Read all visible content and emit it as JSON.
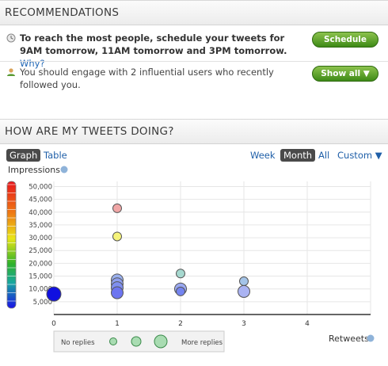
{
  "recommendations": {
    "title": "RECOMMENDATIONS",
    "items": [
      {
        "icon": "clock-icon",
        "text": "To reach the most people, schedule your tweets for 9AM tomorrow, 11AM tomorrow and 3PM tomorrow.",
        "link": "Why?",
        "button": "Schedule"
      },
      {
        "icon": "users-icon",
        "text": "You should engage with 2 influential users who recently followed you.",
        "button": "Show all ▼"
      }
    ]
  },
  "tweets": {
    "title": "HOW ARE MY TWEETS DOING?",
    "view_tabs": [
      "Graph",
      "Table"
    ],
    "active_view": "Graph",
    "range_tabs": [
      "Week",
      "Month",
      "All",
      "Custom ▼"
    ],
    "active_range": "Month"
  },
  "chart_data": {
    "type": "scatter",
    "ylabel": "Impressions",
    "xlabel": "Retweets",
    "xlim": [
      0,
      5
    ],
    "ylim": [
      0,
      52000
    ],
    "x_ticks": [
      "0",
      "1",
      "2",
      "3",
      "4"
    ],
    "y_ticks": [
      "5,000",
      "10,000",
      "15,000",
      "20,000",
      "25,000",
      "30,000",
      "35,000",
      "40,000",
      "45,000",
      "50,000"
    ],
    "colors": {
      "high": "#e8151b",
      "mid": "#f2ee19",
      "low": "#1a12e6"
    },
    "points": [
      {
        "x": 0,
        "y": 8000,
        "replies": 3,
        "color": "#1010e0"
      },
      {
        "x": 1,
        "y": 41500,
        "replies": 1,
        "color": "#f0a6a6"
      },
      {
        "x": 1,
        "y": 30500,
        "replies": 1,
        "color": "#f5f37a"
      },
      {
        "x": 1,
        "y": 13500,
        "replies": 2,
        "color": "#9ab0ee"
      },
      {
        "x": 1,
        "y": 12000,
        "replies": 2,
        "color": "#8e9ff0"
      },
      {
        "x": 1,
        "y": 10500,
        "replies": 2,
        "color": "#7f8ff0"
      },
      {
        "x": 1,
        "y": 8500,
        "replies": 2,
        "color": "#6d75f0"
      },
      {
        "x": 2,
        "y": 16000,
        "replies": 1,
        "color": "#a6d8cf"
      },
      {
        "x": 2,
        "y": 10000,
        "replies": 2,
        "color": "#9aa8f0"
      },
      {
        "x": 2,
        "y": 9000,
        "replies": 1,
        "color": "#7484f0"
      },
      {
        "x": 3,
        "y": 13000,
        "replies": 1,
        "color": "#a4c4e8"
      },
      {
        "x": 3,
        "y": 9000,
        "replies": 2,
        "color": "#aab3f2"
      }
    ],
    "size_legend": {
      "low_label": "No replies",
      "high_label": "More replies"
    }
  }
}
